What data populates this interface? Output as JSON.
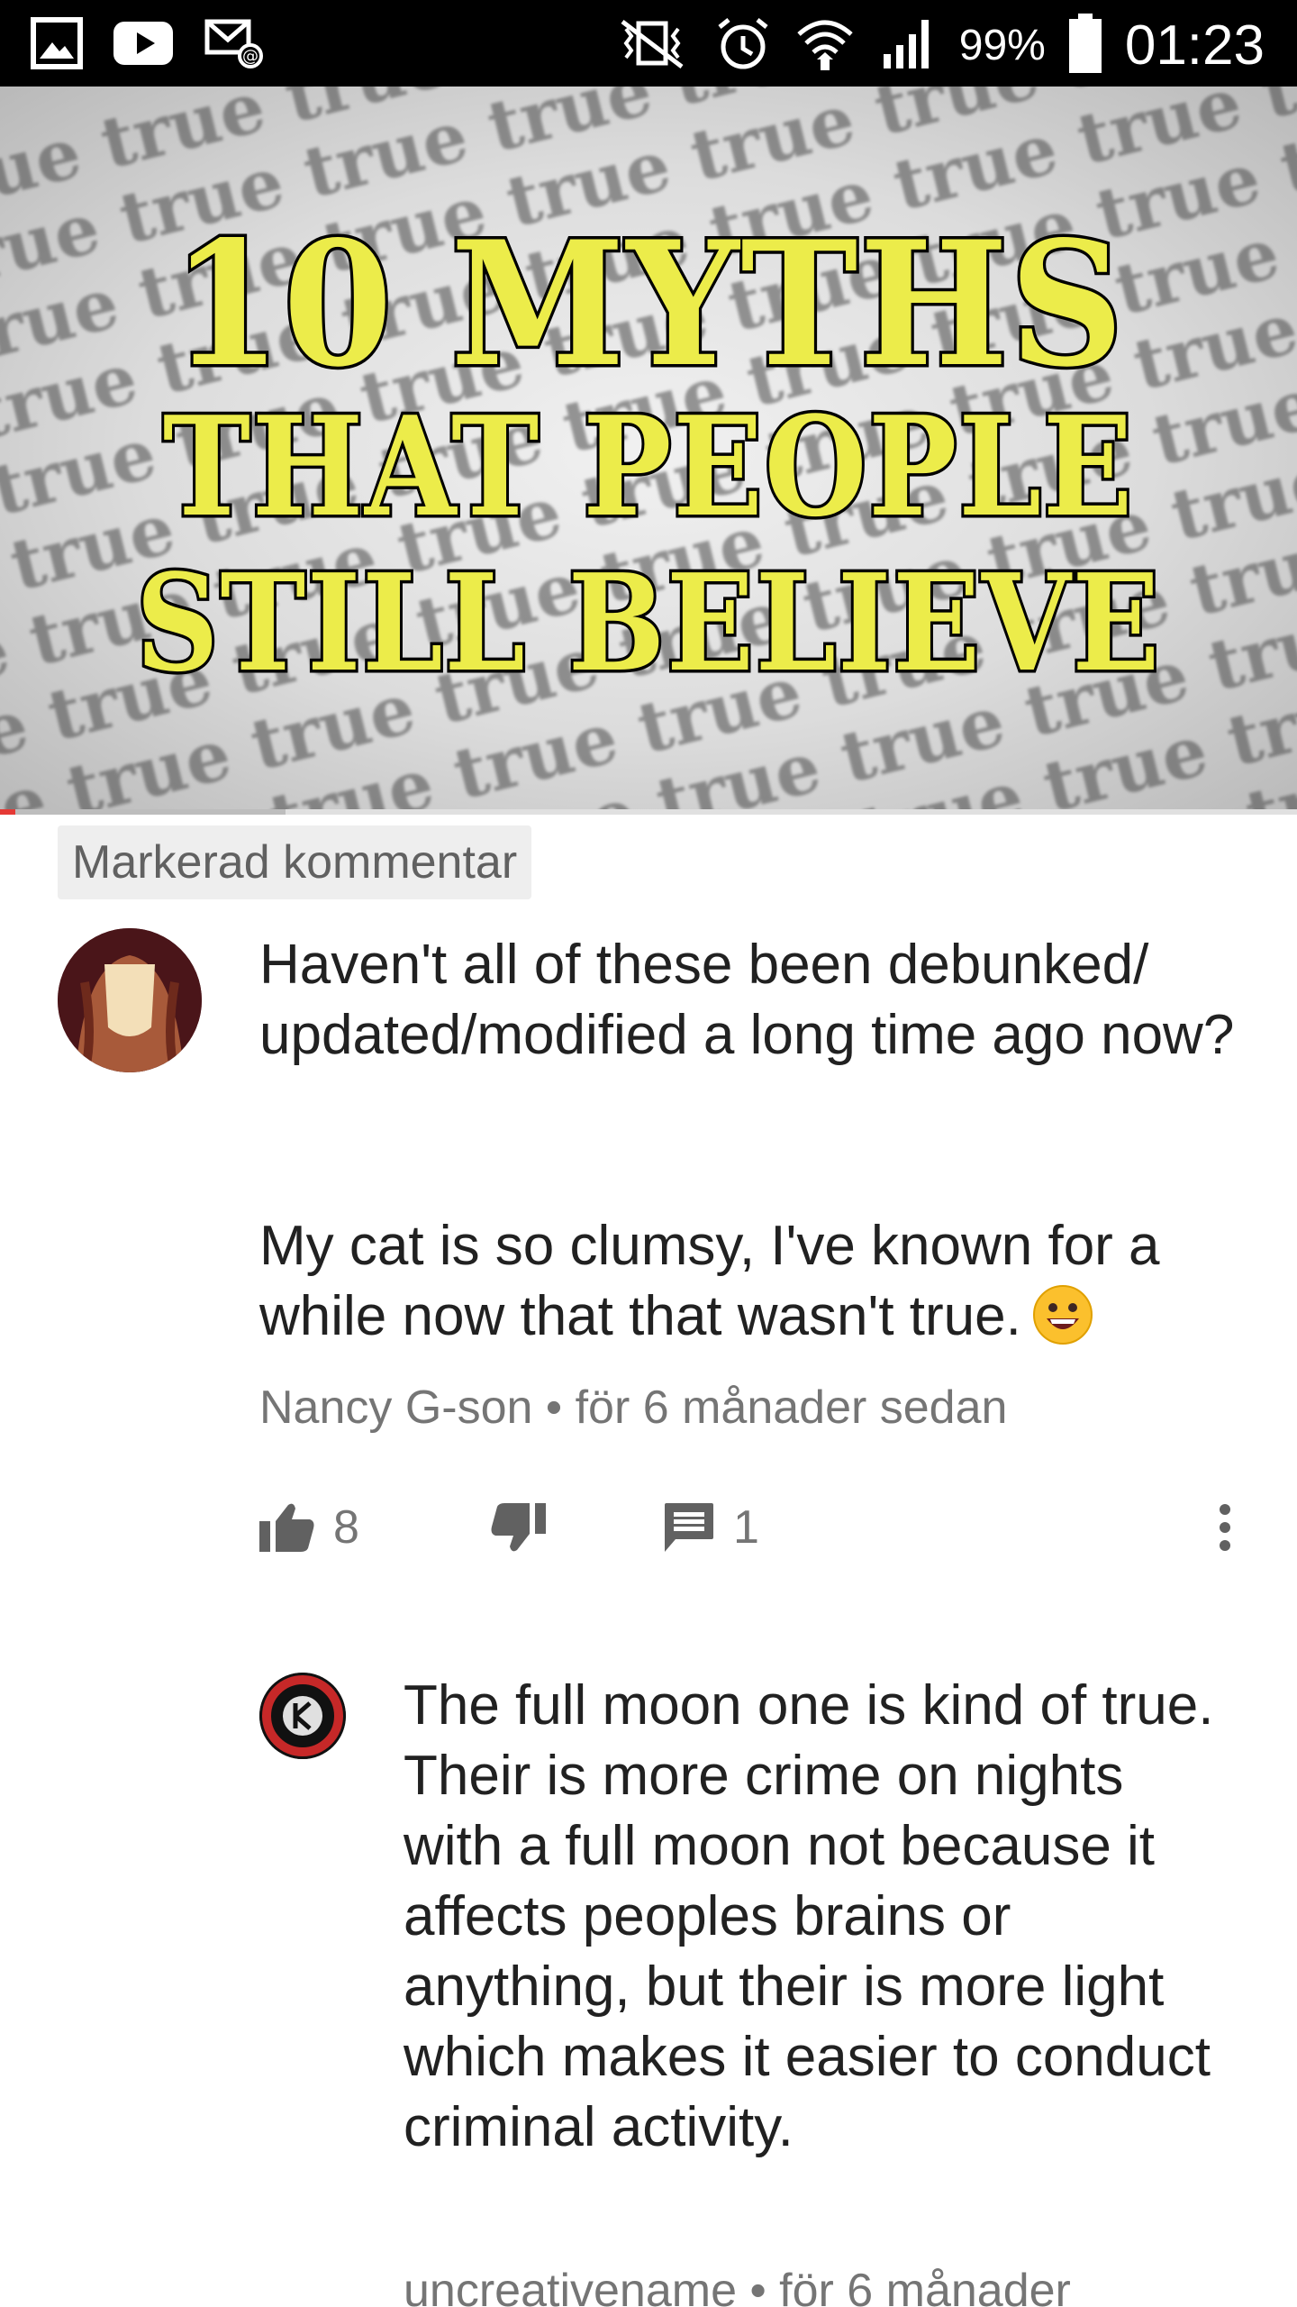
{
  "status_bar": {
    "left_icons": [
      "gallery-icon",
      "youtube-icon",
      "email-at-icon"
    ],
    "right_icons": [
      "mute-vibrate-icon",
      "alarm-icon",
      "wifi-icon",
      "signal-icon",
      "battery-icon"
    ],
    "battery_percent": "99%",
    "time": "01:23"
  },
  "video": {
    "thumbnail_line1": "10 MYTHS",
    "thumbnail_line2": "THAT PEOPLE",
    "thumbnail_line3": "STILL BELIEVE",
    "background_word": "true",
    "progress_fraction": 0.012,
    "buffer_fraction": 0.22,
    "accent_color": "#e53935"
  },
  "highlighted_label": "Markerad kommentar",
  "comment": {
    "text_paragraph1": "Haven't all of these been debunked/ updated/modified a long time ago now?",
    "text_paragraph2": "My cat is so clumsy, I've known for a while now that that wasn't true.",
    "emoji": "grinning-face-icon",
    "author": "Nancy G-son",
    "separator": "•",
    "time_ago": "för 6 månader sedan",
    "likes": "8",
    "replies": "1"
  },
  "reply": {
    "text": "The full moon one is kind of true. Their is more crime on nights with a full moon not because it affects peoples brains or anything, but their is more light which makes it easier to conduct criminal activity.",
    "author": "uncreativename",
    "separator": "•",
    "time_ago": "för 6 månader"
  }
}
